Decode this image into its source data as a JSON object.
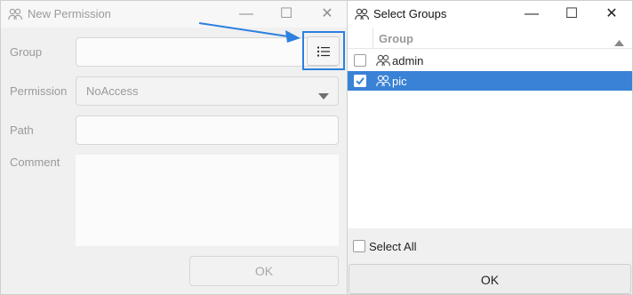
{
  "left_window": {
    "title": "New Permission",
    "controls": {
      "minimize": "—",
      "maximize": "☐",
      "close": "✕"
    },
    "form": {
      "group_label": "Group",
      "group_value": "",
      "permission_label": "Permission",
      "permission_value": "NoAccess",
      "path_label": "Path",
      "path_value": "",
      "comment_label": "Comment",
      "comment_value": ""
    },
    "ok_label": "OK"
  },
  "right_window": {
    "title": "Select Groups",
    "controls": {
      "minimize": "—",
      "maximize": "☐",
      "close": "✕"
    },
    "column_header": "Group",
    "rows": [
      {
        "name": "admin",
        "checked": false,
        "selected": false
      },
      {
        "name": "pic",
        "checked": true,
        "selected": true
      }
    ],
    "select_all_label": "Select All",
    "ok_label": "OK"
  },
  "colors": {
    "accent": "#3a82d6",
    "highlight_box": "#2d7fe0",
    "arrow": "#2d7fe0"
  },
  "icons": [
    "group-icon",
    "list-icon",
    "dropdown-arrow-icon",
    "sort-up-icon",
    "checkbox-check-icon"
  ]
}
